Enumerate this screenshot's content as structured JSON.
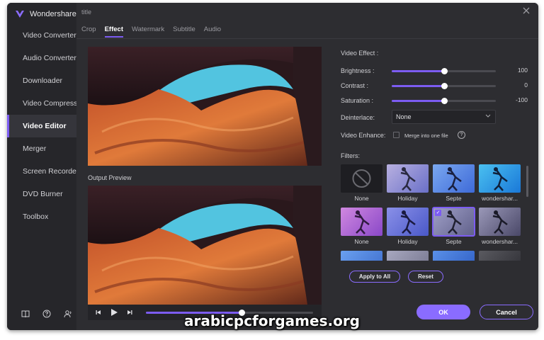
{
  "app": {
    "name": "Wondershare"
  },
  "sidebar": {
    "items": [
      {
        "label": "Video Converter"
      },
      {
        "label": "Audio Converter"
      },
      {
        "label": "Downloader"
      },
      {
        "label": "Video Compressor"
      },
      {
        "label": "Video Editor",
        "active": true
      },
      {
        "label": "Merger"
      },
      {
        "label": "Screen Recorder"
      },
      {
        "label": "DVD Burner"
      },
      {
        "label": "Toolbox"
      }
    ],
    "bottom_icons": [
      "book-icon",
      "help-icon",
      "account-icon"
    ]
  },
  "dialog": {
    "title": "title",
    "tabs": [
      {
        "label": "Crop"
      },
      {
        "label": "Effect",
        "active": true
      },
      {
        "label": "Watermark"
      },
      {
        "label": "Subtitle"
      },
      {
        "label": "Audio"
      }
    ],
    "output_preview_label": "Output Preview",
    "player": {
      "progress": 0.57
    }
  },
  "effect": {
    "heading": "Video Effect :",
    "brightness": {
      "label": "Brightness :",
      "value": "100",
      "position": 0.5
    },
    "contrast": {
      "label": "Contrast :",
      "value": "0",
      "position": 0.5
    },
    "saturation": {
      "label": "Saturation :",
      "value": "-100",
      "position": 0.5
    },
    "deinterlace": {
      "label": "Deinterlace:",
      "value": "None"
    },
    "enhance": {
      "label": "Video Enhance:",
      "checkbox_label": "Merge into one file",
      "checked": false
    },
    "filters_label": "Filters:",
    "filters": [
      {
        "name": "None"
      },
      {
        "name": "Holiday"
      },
      {
        "name": "Septe"
      },
      {
        "name": "wondershar..."
      },
      {
        "name": "None"
      },
      {
        "name": "Holiday"
      },
      {
        "name": "Septe",
        "selected": true
      },
      {
        "name": "wondershar..."
      }
    ],
    "apply_all_label": "Apply to All",
    "reset_label": "Reset"
  },
  "footer": {
    "ok_label": "OK",
    "cancel_label": "Cancel"
  },
  "watermark_text": "arabicpcforgames.org",
  "colors": {
    "accent": "#7c5cf2",
    "background": "#2d2d31",
    "sidebar": "#26262a"
  }
}
